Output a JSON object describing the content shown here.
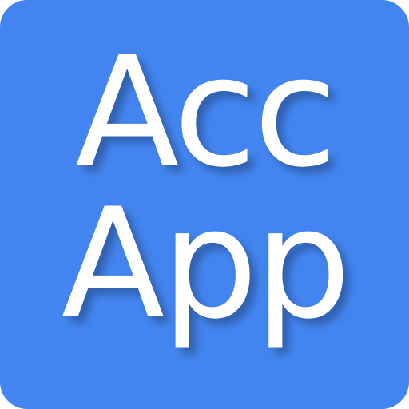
{
  "icon": {
    "background_color": "#4385f0",
    "text_color": "#ffffff",
    "lines": [
      "Acc",
      "App"
    ]
  }
}
